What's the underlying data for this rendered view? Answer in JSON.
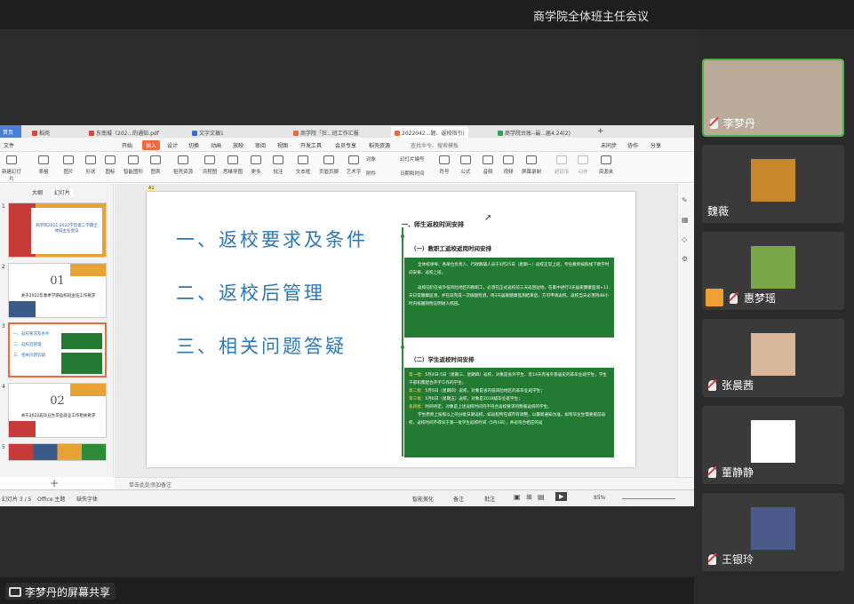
{
  "meeting": {
    "title": "商学院全体班主任会议"
  },
  "share": {
    "label": "李梦丹的屏幕共享"
  },
  "wps": {
    "tabs": [
      "首页",
      "稻壳",
      "东南城（202...的通知.pdf",
      "文字文稿1",
      "商学院「狂...班工作汇报",
      "2022042...题、返校指引)",
      "商学院台账--最...届4.24(2)"
    ],
    "menus": [
      "文件",
      "开始",
      "插入",
      "设计",
      "切换",
      "动画",
      "放映",
      "审阅",
      "视图",
      "开发工具",
      "会员专享",
      "稻壳资源"
    ],
    "menu_search": "查找命令、搜索模板",
    "menu_right": [
      "未同步",
      "协作",
      "分享"
    ],
    "tools": [
      "新建幻灯片",
      "表格",
      "图片",
      "形状",
      "图标",
      "智能图形",
      "图表",
      "稻壳资源",
      "流程图",
      "思维导图",
      "更多",
      "批注",
      "文本框",
      "页眉页脚",
      "艺术字",
      "附件",
      "日期和时间",
      "符号",
      "公式",
      "音频",
      "视频",
      "屏幕录制",
      "超链接",
      "动作",
      "资源夹"
    ],
    "tool_extra": [
      "对象",
      "幻灯片编号"
    ],
    "thumb_tabs": [
      "大纲",
      "幻灯片"
    ],
    "thumbs": [
      {
        "num": "1",
        "text": "商学院2021-2022学年第二学期全体班主任会议"
      },
      {
        "num": "2",
        "big": "01",
        "text": "关于2022年春季学期返校班主任工作要求"
      },
      {
        "num": "3",
        "lines": [
          "一、返校要求及条件",
          "二、返校后管理",
          "三、相关问题答疑"
        ]
      },
      {
        "num": "4",
        "big": "02",
        "text": "关于2022届毕业生毕业就业工作相关要求"
      },
      {
        "num": "5"
      }
    ],
    "slide": {
      "label": "A1",
      "items": [
        "一、返校要求及条件",
        "二、返校后管理",
        "三、相关问题答疑"
      ],
      "section": "一、师生返校时间安排",
      "sub1": "（一）教职工返校返岗时间安排",
      "box1_p1": "全体校领导、各单位负责人、行政教辅人员于4月25日（星期一）返校正常上班，专任教师按照线下教学时间安排，返校上班。",
      "box1_p2": "返校前仍在省外低风险地区的教职工，必须在正式返校前三天返回驻地，在家中进行3天居家健康监测+11天日常健康监测，并在前完成一次核酸检测，待3天居家健康监测结束后，方可申请返校。返校当天必须持48小时内核酸阴性证明进入校园。",
      "sub2": "（二）学生返校时间安排",
      "box2_lines": [
        {
          "tag": "第一批：",
          "text": "5月4日-5日（星期三、星期四）返校，对象是省外学生、近14天有省外旅居史的非毕业班学生，学生干部和需配合开学工作的学生；"
        },
        {
          "tag": "第二批：",
          "text": "5月5日（星期四）返校，对象是省内低风险地区的非毕业班学生；"
        },
        {
          "tag": "第三批：",
          "text": "5月6日（星期五）返校，对象是2018级毕业班学生；"
        },
        {
          "tag": "第四批：",
          "text": "时间待定，对象是上述返校时间内不符合返校要求的暂缓返校的学生。"
        },
        {
          "tag": "",
          "text": "学生原则上按照以上的分批日期返校，如返程所在城市有调整，以最新通知为准。如有毕业生需要提前返校，返校时间不得早于第一批学生返校时间（5月4日），并必符合相应的返"
        }
      ]
    },
    "note_hint": "单击此处添加备注",
    "status": {
      "slide": "幻灯片 3 / 5",
      "theme": "Office 主题",
      "font": "缺失字体",
      "beautify": "智能美化",
      "notes": "备注",
      "comment": "批注",
      "zoom": "85%"
    }
  },
  "participants": [
    {
      "name": "李梦丹",
      "bg": "#b9aa9a"
    },
    {
      "name": "魏薇",
      "bg": "#c8872a"
    },
    {
      "name": "惠梦瑶",
      "bg": "#7aa848"
    },
    {
      "name": "张晨茜",
      "bg": "#d8b89a"
    },
    {
      "name": "董静静",
      "bg": "#ffffff"
    },
    {
      "name": "王银玲",
      "bg": "#4a5a8a"
    }
  ]
}
